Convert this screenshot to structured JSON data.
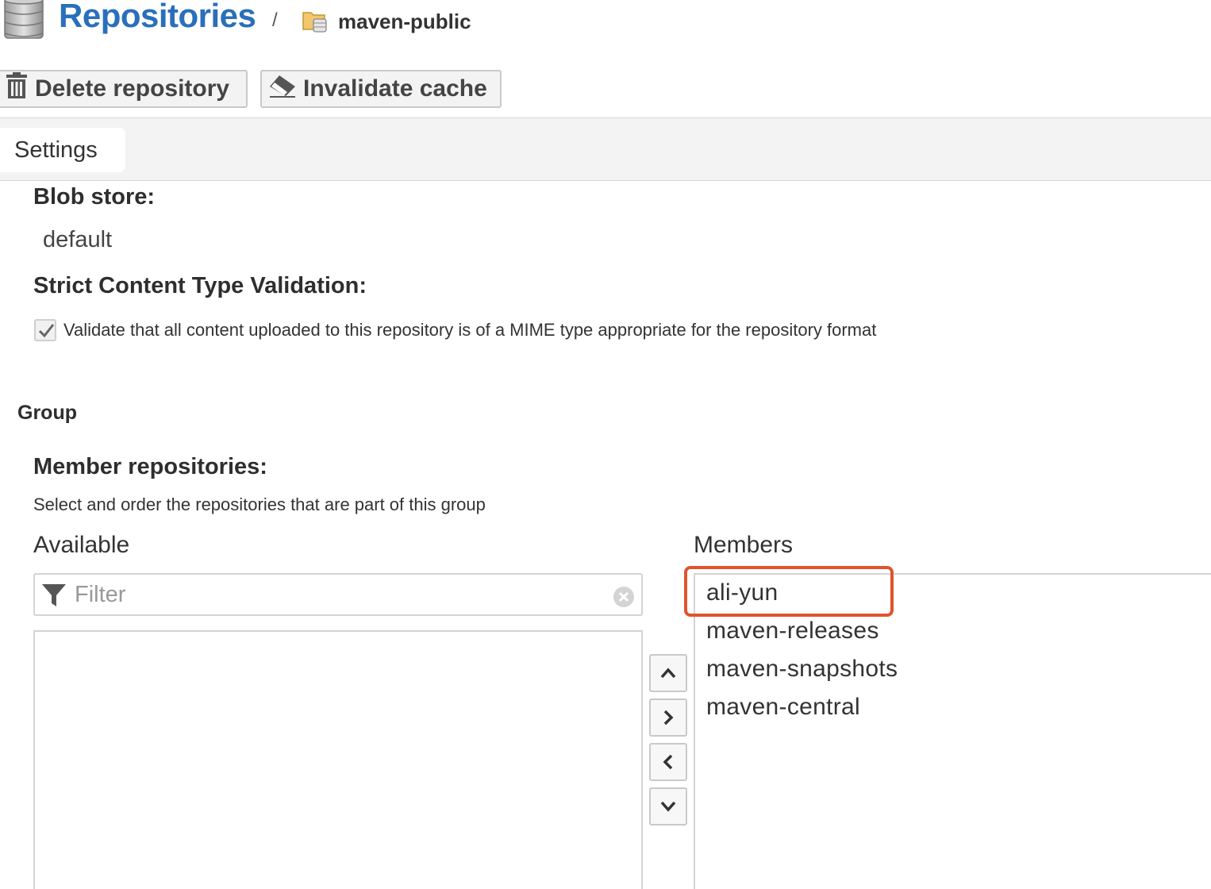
{
  "breadcrumb": {
    "root": "Repositories",
    "separator": "/",
    "current": "maven-public",
    "root_icon": "database-icon",
    "current_icon": "folder-repo-icon"
  },
  "toolbar": {
    "delete_label": "Delete repository",
    "delete_icon": "trash-icon",
    "invalidate_label": "Invalidate cache",
    "invalidate_icon": "eraser-icon"
  },
  "tabs": [
    {
      "label": "Settings",
      "active": true
    }
  ],
  "form": {
    "blob_store_label": "Blob store:",
    "blob_store_value": "default",
    "strict_label": "Strict Content Type Validation:",
    "strict_checked": true,
    "strict_description": "Validate that all content uploaded to this repository is of a MIME type appropriate for the repository format",
    "group_section": "Group",
    "members_label": "Member repositories:",
    "members_description": "Select and order the repositories that are part of this group",
    "available_title": "Available",
    "members_title": "Members",
    "filter_placeholder": "Filter",
    "filter_value": "",
    "available_items": [],
    "members": [
      "ali-yun",
      "maven-releases",
      "maven-snapshots",
      "maven-central"
    ],
    "highlighted_member": "ali-yun"
  },
  "colors": {
    "link_blue": "#2a6fba",
    "highlight_orange": "#e0542d",
    "tabstrip_bg": "#f3f3f3"
  }
}
